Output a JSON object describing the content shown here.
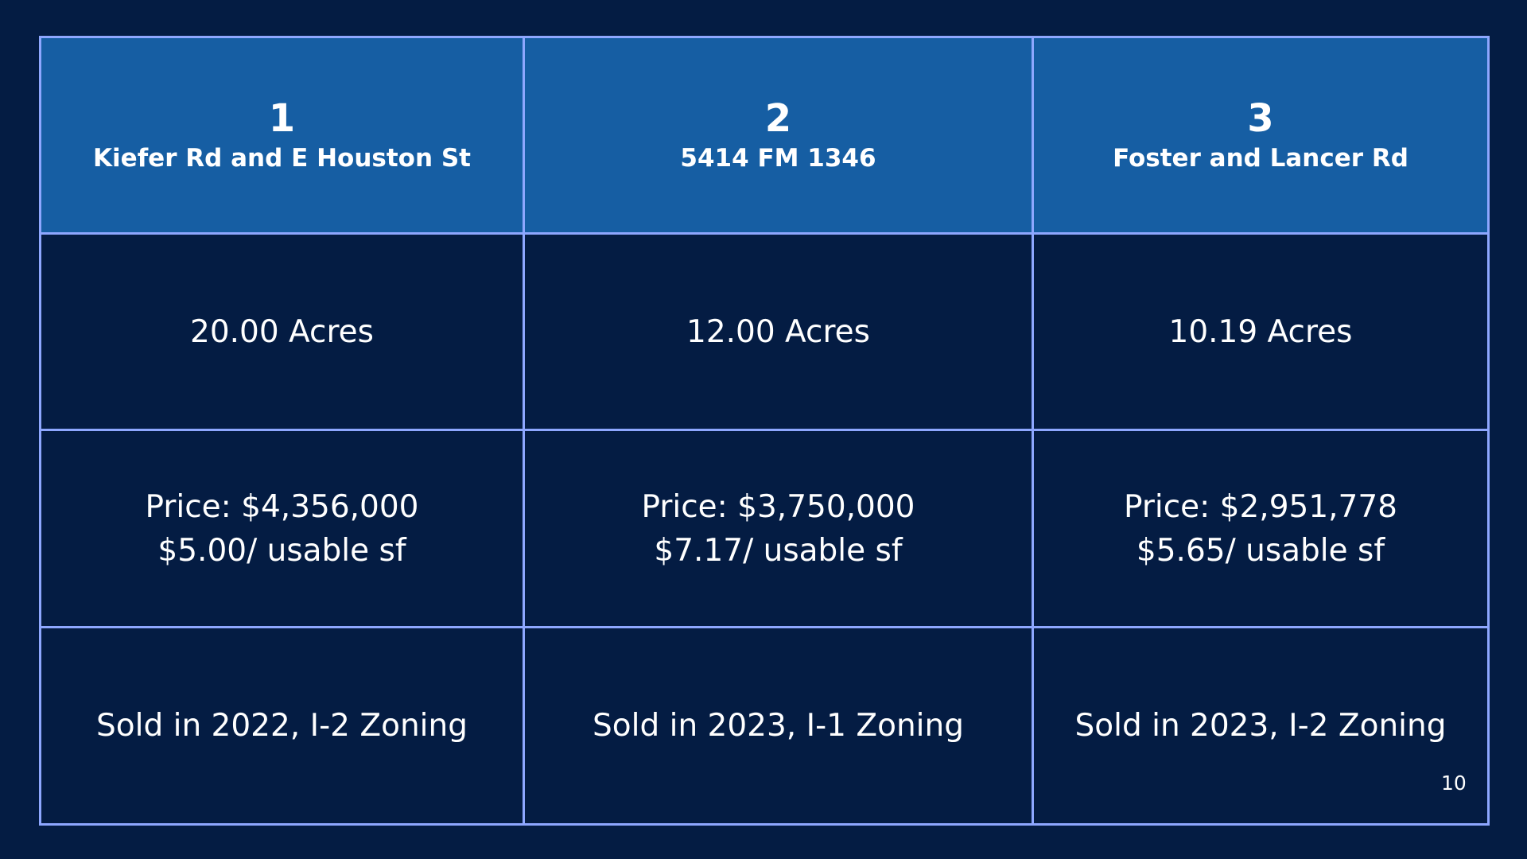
{
  "colors": {
    "background": "#041c43",
    "header_background": "#165ea3",
    "grid_lines": "#8ea7ff",
    "text": "#ffffff"
  },
  "properties": [
    {
      "number": "1",
      "address": "Kiefer Rd and E Houston St",
      "acreage": "20.00 Acres",
      "price": "Price: $4,356,000",
      "price_per_sf": "$5.00/ usable sf",
      "sale_info": "Sold in 2022, I-2 Zoning"
    },
    {
      "number": "2",
      "address": "5414 FM 1346",
      "acreage": "12.00 Acres",
      "price": "Price: $3,750,000",
      "price_per_sf": "$7.17/ usable sf",
      "sale_info": "Sold in 2023, I-1 Zoning"
    },
    {
      "number": "3",
      "address": "Foster and Lancer Rd",
      "acreage": "10.19 Acres",
      "price": "Price: $2,951,778",
      "price_per_sf": "$5.65/ usable sf",
      "sale_info": "Sold in 2023, I-2 Zoning"
    }
  ],
  "page_number": "10"
}
